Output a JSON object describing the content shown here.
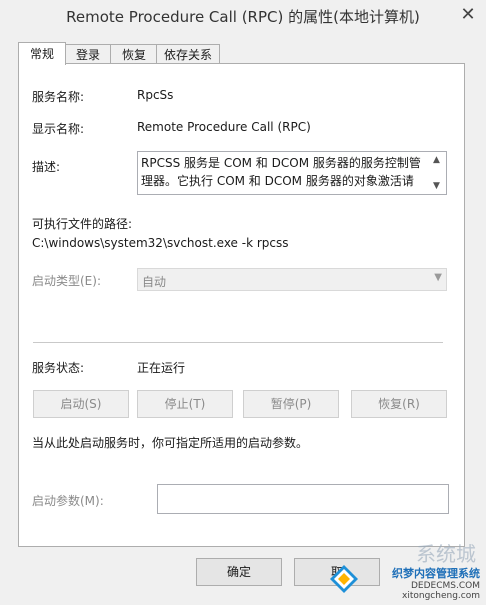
{
  "window": {
    "title": "Remote Procedure Call (RPC) 的属性(本地计算机)",
    "close_glyph": "✕"
  },
  "tabs": [
    {
      "label": "常规"
    },
    {
      "label": "登录"
    },
    {
      "label": "恢复"
    },
    {
      "label": "依存关系"
    }
  ],
  "general": {
    "service_name_label": "服务名称:",
    "service_name_value": "RpcSs",
    "display_name_label": "显示名称:",
    "display_name_value": "Remote Procedure Call (RPC)",
    "description_label": "描述:",
    "description_value": "RPCSS 服务是 COM 和 DCOM 服务器的服务控制管理器。它执行 COM 和 DCOM 服务器的对象激活请",
    "path_label": "可执行文件的路径:",
    "path_value": "C:\\windows\\system32\\svchost.exe -k rpcss",
    "startup_type_label": "启动类型(E):",
    "startup_type_value": "自动",
    "status_label": "服务状态:",
    "status_value": "正在运行",
    "buttons": {
      "start": "启动(S)",
      "stop": "停止(T)",
      "pause": "暂停(P)",
      "resume": "恢复(R)"
    },
    "hint": "当从此处启动服务时，你可指定所适用的启动参数。",
    "start_params_label": "启动参数(M):",
    "start_params_value": ""
  },
  "dialog_buttons": {
    "ok": "确定",
    "cancel": "取"
  },
  "watermark": {
    "line1": "织梦内容管理系统",
    "line2": "DEDECMS.COM",
    "line3": "系统城",
    "site": "xitongcheng.com"
  },
  "colors": {
    "accent": "#1e6fb8",
    "disabled_text": "#8a8a8a",
    "border": "#adadad"
  }
}
